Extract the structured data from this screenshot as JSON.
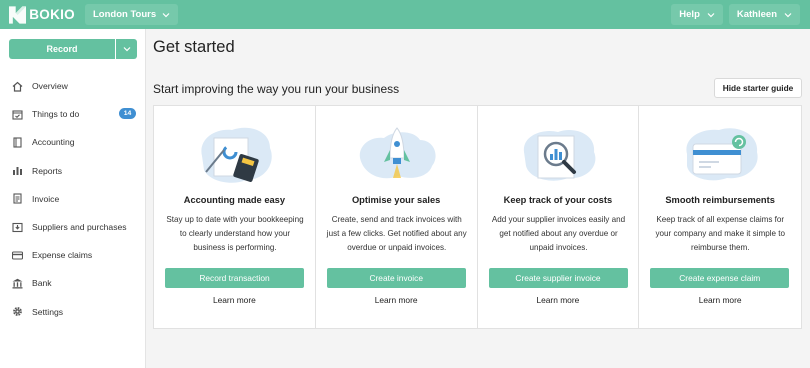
{
  "brand": {
    "name": "BOKIO",
    "color": "#64c1a0"
  },
  "topbar": {
    "company": "London Tours",
    "help_label": "Help",
    "user_label": "Kathleen"
  },
  "sidebar": {
    "record_label": "Record",
    "items": [
      {
        "label": "Overview",
        "icon": "home-icon"
      },
      {
        "label": "Things to do",
        "icon": "calendar-check-icon",
        "badge": "14"
      },
      {
        "label": "Accounting",
        "icon": "book-icon"
      },
      {
        "label": "Reports",
        "icon": "bar-chart-icon"
      },
      {
        "label": "Invoice",
        "icon": "invoice-icon"
      },
      {
        "label": "Suppliers and purchases",
        "icon": "inbox-icon"
      },
      {
        "label": "Expense claims",
        "icon": "card-icon"
      },
      {
        "label": "Bank",
        "icon": "bank-icon"
      },
      {
        "label": "Settings",
        "icon": "gear-icon"
      }
    ]
  },
  "main": {
    "title": "Get started",
    "subtitle": "Start improving the way you run your business",
    "hide_guide_label": "Hide starter guide",
    "cards": [
      {
        "title": "Accounting made easy",
        "desc": "Stay up to date with your bookkeeping to clearly understand how your business is performing.",
        "button": "Record transaction",
        "link": "Learn more",
        "illustration": "calculator-icon"
      },
      {
        "title": "Optimise your sales",
        "desc": "Create, send and track invoices with just a few clicks. Get notified about any overdue or unpaid invoices.",
        "button": "Create invoice",
        "link": "Learn more",
        "illustration": "rocket-icon"
      },
      {
        "title": "Keep track of your costs",
        "desc": "Add your supplier invoices easily and get notified about any overdue or unpaid invoices.",
        "button": "Create supplier invoice",
        "link": "Learn more",
        "illustration": "magnifier-chart-icon"
      },
      {
        "title": "Smooth reimbursements",
        "desc": "Keep track of all expense claims for your company and make it simple to reimburse them.",
        "button": "Create expense claim",
        "link": "Learn more",
        "illustration": "refund-card-icon"
      }
    ]
  }
}
